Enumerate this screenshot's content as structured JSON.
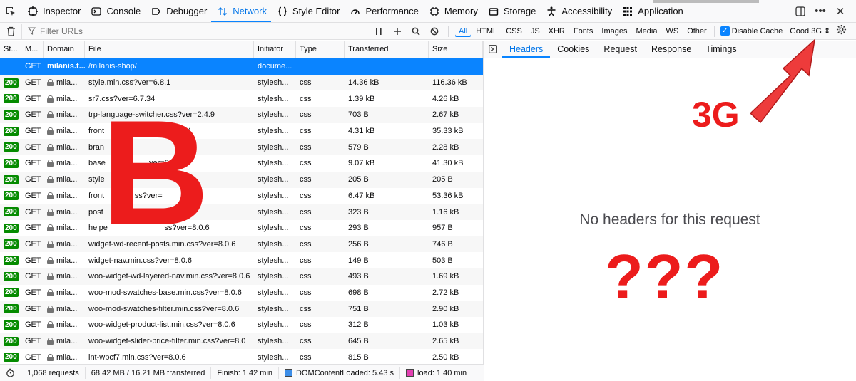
{
  "toolbox": {
    "tabs": [
      {
        "label": "Inspector",
        "icon": "inspector-icon"
      },
      {
        "label": "Console",
        "icon": "console-icon"
      },
      {
        "label": "Debugger",
        "icon": "debugger-icon"
      },
      {
        "label": "Network",
        "icon": "network-icon",
        "active": true
      },
      {
        "label": "Style Editor",
        "icon": "style-editor-icon"
      },
      {
        "label": "Performance",
        "icon": "performance-icon"
      },
      {
        "label": "Memory",
        "icon": "memory-icon"
      },
      {
        "label": "Storage",
        "icon": "storage-icon"
      },
      {
        "label": "Accessibility",
        "icon": "accessibility-icon"
      },
      {
        "label": "Application",
        "icon": "application-icon"
      }
    ],
    "overflow_label": "•••",
    "close_label": "✕"
  },
  "filterbar": {
    "placeholder": "Filter URLs",
    "types": [
      "All",
      "HTML",
      "CSS",
      "JS",
      "XHR",
      "Fonts",
      "Images",
      "Media",
      "WS",
      "Other"
    ],
    "active_type": "All",
    "disable_cache_label": "Disable Cache",
    "disable_cache_checked": true,
    "throttle_label": "Good 3G ⇕"
  },
  "table": {
    "columns": [
      "St...",
      "M...",
      "Domain",
      "File",
      "Initiator",
      "Type",
      "Transferred",
      "Size"
    ],
    "rows": [
      {
        "status": "",
        "method": "GET",
        "domain": "milanis.t...",
        "file": "/milanis-shop/",
        "initiator": "docume...",
        "type": "",
        "transferred": "",
        "size": "",
        "selected": true
      },
      {
        "status": "200",
        "method": "GET",
        "domain": "mila...",
        "file": "style.min.css?ver=6.8.1",
        "initiator": "stylesh...",
        "type": "css",
        "transferred": "14.36 kB",
        "size": "116.36 kB"
      },
      {
        "status": "200",
        "method": "GET",
        "domain": "mila...",
        "file": "sr7.css?ver=6.7.34",
        "initiator": "stylesh...",
        "type": "css",
        "transferred": "1.39 kB",
        "size": "4.26 kB"
      },
      {
        "status": "200",
        "method": "GET",
        "domain": "mila...",
        "file": "trp-language-switcher.css?ver=2.4.9",
        "initiator": "stylesh...",
        "type": "css",
        "transferred": "703 B",
        "size": "2.67 kB"
      },
      {
        "status": "200",
        "method": "GET",
        "domain": "mila...",
        "file": "front                              69194",
        "initiator": "stylesh...",
        "type": "css",
        "transferred": "4.31 kB",
        "size": "35.33 kB"
      },
      {
        "status": "200",
        "method": "GET",
        "domain": "mila...",
        "file": "bran",
        "initiator": "stylesh...",
        "type": "css",
        "transferred": "579 B",
        "size": "2.28 kB"
      },
      {
        "status": "200",
        "method": "GET",
        "domain": "mila...",
        "file": "base                    ver=8.0",
        "initiator": "stylesh...",
        "type": "css",
        "transferred": "9.07 kB",
        "size": "41.30 kB"
      },
      {
        "status": "200",
        "method": "GET",
        "domain": "mila...",
        "file": "style",
        "initiator": "stylesh...",
        "type": "css",
        "transferred": "205 B",
        "size": "205 B"
      },
      {
        "status": "200",
        "method": "GET",
        "domain": "mila...",
        "file": "front              ss?ver=",
        "initiator": "stylesh...",
        "type": "css",
        "transferred": "6.47 kB",
        "size": "53.36 kB"
      },
      {
        "status": "200",
        "method": "GET",
        "domain": "mila...",
        "file": "post",
        "initiator": "stylesh...",
        "type": "css",
        "transferred": "323 B",
        "size": "1.16 kB"
      },
      {
        "status": "200",
        "method": "GET",
        "domain": "mila...",
        "file": "helpe                          ss?ver=8.0.6",
        "initiator": "stylesh...",
        "type": "css",
        "transferred": "293 B",
        "size": "957 B"
      },
      {
        "status": "200",
        "method": "GET",
        "domain": "mila...",
        "file": "widget-wd-recent-posts.min.css?ver=8.0.6",
        "initiator": "stylesh...",
        "type": "css",
        "transferred": "256 B",
        "size": "746 B"
      },
      {
        "status": "200",
        "method": "GET",
        "domain": "mila...",
        "file": "widget-nav.min.css?ver=8.0.6",
        "initiator": "stylesh...",
        "type": "css",
        "transferred": "149 B",
        "size": "503 B"
      },
      {
        "status": "200",
        "method": "GET",
        "domain": "mila...",
        "file": "woo-widget-wd-layered-nav.min.css?ver=8.0.6",
        "initiator": "stylesh...",
        "type": "css",
        "transferred": "493 B",
        "size": "1.69 kB"
      },
      {
        "status": "200",
        "method": "GET",
        "domain": "mila...",
        "file": "woo-mod-swatches-base.min.css?ver=8.0.6",
        "initiator": "stylesh...",
        "type": "css",
        "transferred": "698 B",
        "size": "2.72 kB"
      },
      {
        "status": "200",
        "method": "GET",
        "domain": "mila...",
        "file": "woo-mod-swatches-filter.min.css?ver=8.0.6",
        "initiator": "stylesh...",
        "type": "css",
        "transferred": "751 B",
        "size": "2.90 kB"
      },
      {
        "status": "200",
        "method": "GET",
        "domain": "mila...",
        "file": "woo-widget-product-list.min.css?ver=8.0.6",
        "initiator": "stylesh...",
        "type": "css",
        "transferred": "312 B",
        "size": "1.03 kB"
      },
      {
        "status": "200",
        "method": "GET",
        "domain": "mila...",
        "file": "woo-widget-slider-price-filter.min.css?ver=8.0",
        "initiator": "stylesh...",
        "type": "css",
        "transferred": "645 B",
        "size": "2.65 kB"
      },
      {
        "status": "200",
        "method": "GET",
        "domain": "mila...",
        "file": "int-wpcf7.min.css?ver=8.0.6",
        "initiator": "stylesh...",
        "type": "css",
        "transferred": "815 B",
        "size": "2.50 kB"
      }
    ]
  },
  "statusbar": {
    "requests": "1,068 requests",
    "transferred": "68.42 MB / 16.21 MB transferred",
    "finish": "Finish: 1.42 min",
    "dom_loaded": "DOMContentLoaded: 5.43 s",
    "load": "load: 1.40 min",
    "dom_color": "#3d8ee8",
    "load_color": "#e23fb1"
  },
  "details": {
    "tabs": [
      "Headers",
      "Cookies",
      "Request",
      "Response",
      "Timings"
    ],
    "active_tab": "Headers",
    "empty_message": "No headers for this request"
  },
  "annotations": {
    "big_letter": "B",
    "network_label": "3G",
    "question": "???",
    "color": "#ec1c1c"
  }
}
